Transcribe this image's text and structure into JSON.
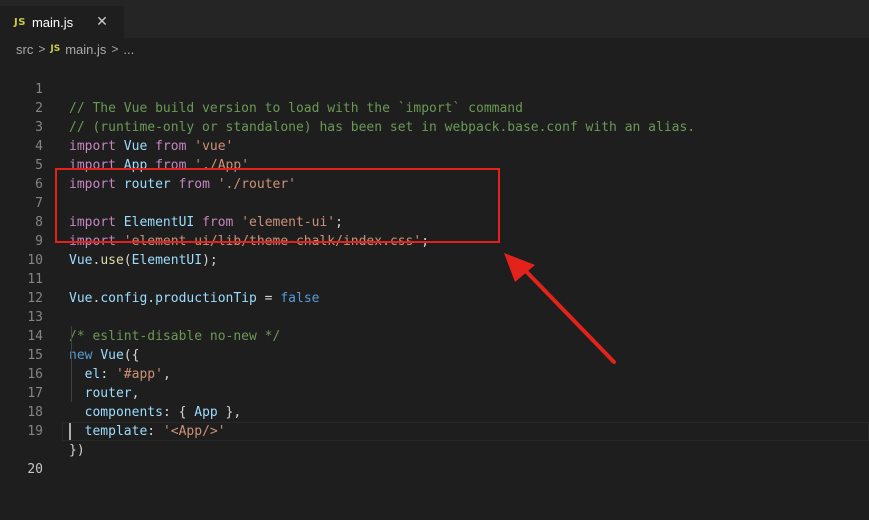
{
  "tab": {
    "icon": "js-file-icon",
    "name": "main.js",
    "close_icon": "close-icon",
    "close_glyph": "✕"
  },
  "breadcrumb": {
    "folder": "src",
    "file": "main.js",
    "more": "..."
  },
  "editor": {
    "lines": [
      {
        "num": "1"
      },
      {
        "num": "2"
      },
      {
        "num": "3"
      },
      {
        "num": "4"
      },
      {
        "num": "5"
      },
      {
        "num": "6"
      },
      {
        "num": "7"
      },
      {
        "num": "8"
      },
      {
        "num": "9"
      },
      {
        "num": "10"
      },
      {
        "num": "11"
      },
      {
        "num": "12"
      },
      {
        "num": "13"
      },
      {
        "num": "14"
      },
      {
        "num": "15"
      },
      {
        "num": "16"
      },
      {
        "num": "17"
      },
      {
        "num": "18"
      },
      {
        "num": "19"
      },
      {
        "num": "20"
      }
    ],
    "code": {
      "l1": "// The Vue build version to load with the `import` command",
      "l2": "// (runtime-only or standalone) has been set in webpack.base.conf with an alias.",
      "l3_kw": "import",
      "l3_id": "Vue",
      "l3_from": "from",
      "l3_str": "'vue'",
      "l4_kw": "import",
      "l4_id": "App",
      "l4_from": "from",
      "l4_str": "'./App'",
      "l5_kw": "import",
      "l5_id": "router",
      "l5_from": "from",
      "l5_str": "'./router'",
      "l7_kw": "import",
      "l7_id": "ElementUI",
      "l7_from": "from",
      "l7_str": "'element-ui'",
      "l7_semi": ";",
      "l8_kw": "import",
      "l8_str": "'element-ui/lib/theme-chalk/index.css'",
      "l8_semi": ";",
      "l9_obj": "Vue",
      "l9_dot": ".",
      "l9_fn": "use",
      "l9_open": "(",
      "l9_arg": "ElementUI",
      "l9_close": ");",
      "l11_obj": "Vue",
      "l11_dot1": ".",
      "l11_prop1": "config",
      "l11_dot2": ".",
      "l11_prop2": "productionTip",
      "l11_eq": " = ",
      "l11_val": "false",
      "l13": "/* eslint-disable no-new */",
      "l14_kw": "new",
      "l14_cls": "Vue",
      "l14_rest": "({",
      "l15_key": "el",
      "l15_colon": ": ",
      "l15_str": "'#app'",
      "l15_comma": ",",
      "l16_key": "router",
      "l16_comma": ",",
      "l17_key": "components",
      "l17_mid": ": { ",
      "l17_id": "App",
      "l17_end": " },",
      "l18_key": "template",
      "l18_colon": ": ",
      "l18_str": "'<App/>'",
      "l19": "})"
    }
  },
  "annotation": {
    "color": "#e3221c",
    "meaning": "highlight-box-with-arrow"
  }
}
